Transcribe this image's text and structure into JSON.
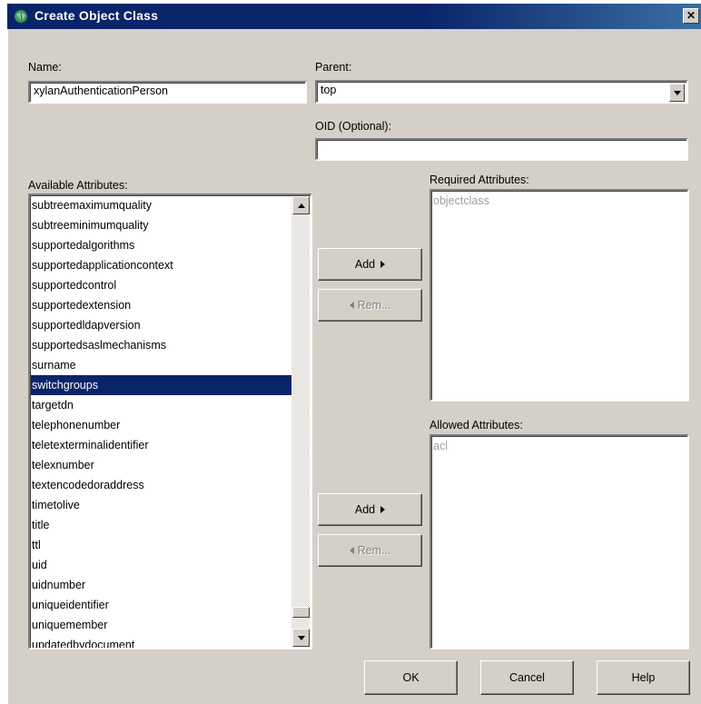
{
  "window": {
    "title": "Create Object Class",
    "close_label": "✕"
  },
  "name": {
    "label": "Name:",
    "value": "xylanAuthenticationPerson"
  },
  "parent": {
    "label": "Parent:",
    "value": "top"
  },
  "oid": {
    "label": "OID (Optional):",
    "value": ""
  },
  "available": {
    "label": "Available Attributes:",
    "items": [
      "subtreemaximumquality",
      "subtreeminimumquality",
      "supportedalgorithms",
      "supportedapplicationcontext",
      "supportedcontrol",
      "supportedextension",
      "supportedldapversion",
      "supportedsaslmechanisms",
      "surname",
      "switchgroups",
      "targetdn",
      "telephonenumber",
      "teletexterminalidentifier",
      "telexnumber",
      "textencodedoraddress",
      "timetolive",
      "title",
      "ttl",
      "uid",
      "uidnumber",
      "uniqueidentifier",
      "uniquemember",
      "updatedbydocument"
    ],
    "selected": "switchgroups"
  },
  "required": {
    "label": "Required Attributes:",
    "items": [
      "objectclass"
    ],
    "add_label": "Add",
    "remove_label": "Rem..."
  },
  "allowed": {
    "label": "Allowed Attributes:",
    "items": [
      "acl"
    ],
    "add_label": "Add",
    "remove_label": "Rem..."
  },
  "footer": {
    "ok_label": "OK",
    "cancel_label": "Cancel",
    "help_label": "Help"
  },
  "colors": {
    "titlebar": "#0a246a",
    "dialog_bg": "#d4d0c8",
    "selection": "#0a246a"
  },
  "icons": {
    "title": "object-class-icon",
    "close": "close-icon",
    "dropdown": "chevron-down-icon",
    "scroll_up": "scroll-up-icon",
    "scroll_down": "scroll-down-icon",
    "add": "arrow-right-icon",
    "remove": "arrow-left-icon"
  }
}
